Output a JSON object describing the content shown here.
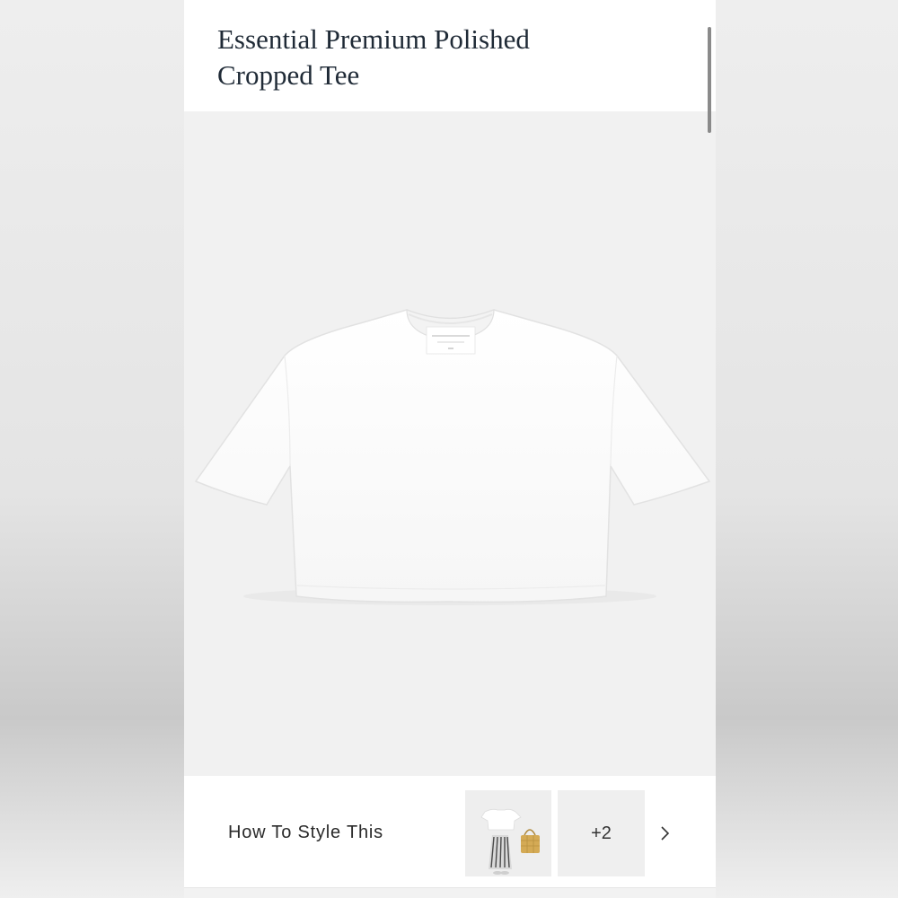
{
  "product": {
    "title_line1": "Essential Premium Polished",
    "title_line2": "Cropped Tee",
    "image_icon": "cropped-tee-image"
  },
  "style_section": {
    "label": "How To Style This",
    "thumbnail_icon": "outfit-thumbnail",
    "more_count": "+2",
    "next_icon": "chevron-right-icon"
  },
  "colors": {
    "title_text": "#1f2a36",
    "image_background": "#f1f1f1",
    "panel_background": "#ffffff"
  }
}
